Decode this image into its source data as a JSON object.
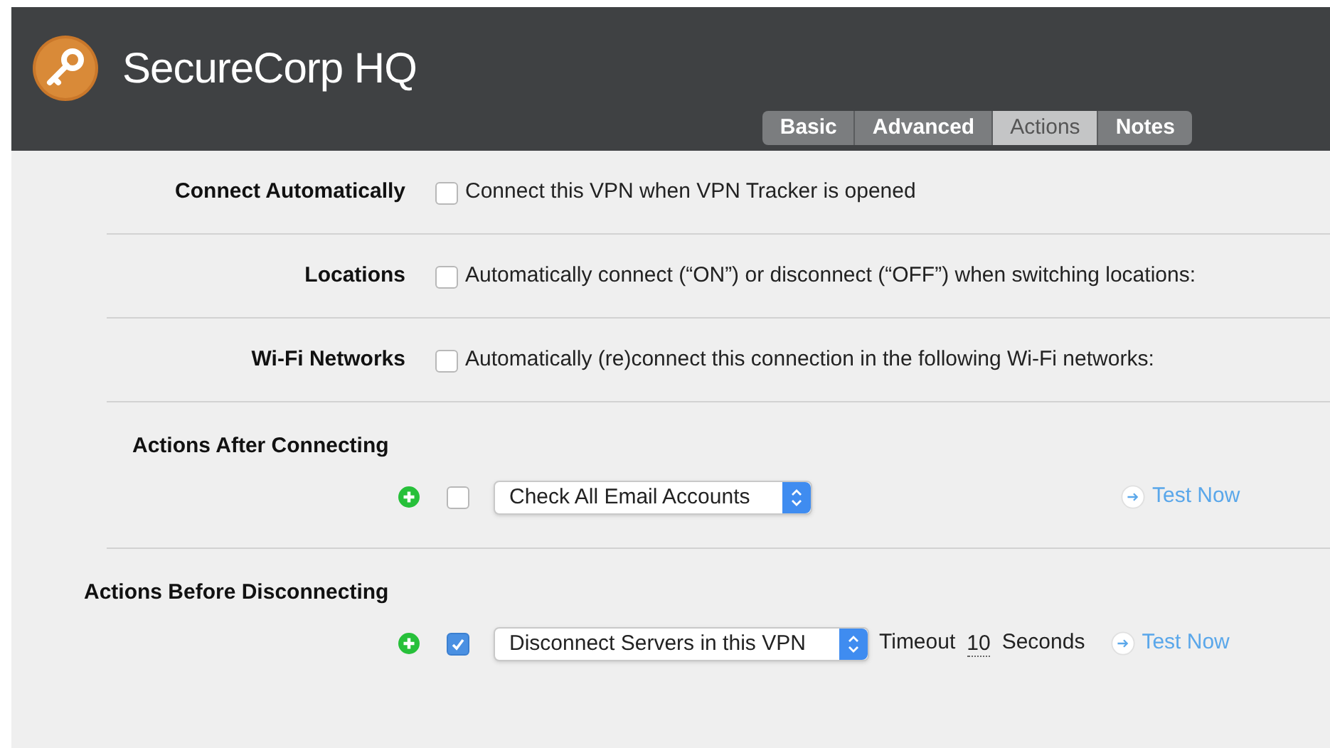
{
  "header": {
    "title": "SecureCorp HQ"
  },
  "tabs": [
    {
      "label": "Basic",
      "selected": false
    },
    {
      "label": "Advanced",
      "selected": false
    },
    {
      "label": "Actions",
      "selected": true
    },
    {
      "label": "Notes",
      "selected": false
    }
  ],
  "settings": [
    {
      "label": "Connect Automatically",
      "option": "Connect this VPN when VPN Tracker is opened",
      "checked": false
    },
    {
      "label": "Locations",
      "option": "Automatically connect (“ON”) or disconnect (“OFF”) when switching locations:",
      "checked": false
    },
    {
      "label": "Wi-Fi Networks",
      "option": "Automatically (re)connect this connection in the following Wi-Fi networks:",
      "checked": false
    }
  ],
  "action_groups": [
    {
      "heading": "Actions After Connecting",
      "action": {
        "checked": false,
        "value": "Check All Email Accounts",
        "test": "Test Now"
      }
    },
    {
      "heading": "Actions Before Disconnecting",
      "action": {
        "checked": true,
        "value": "Disconnect Servers in this VPN",
        "timeout_label": "Timeout",
        "timeout_value": "10",
        "timeout_unit": "Seconds",
        "test": "Test Now"
      }
    }
  ]
}
